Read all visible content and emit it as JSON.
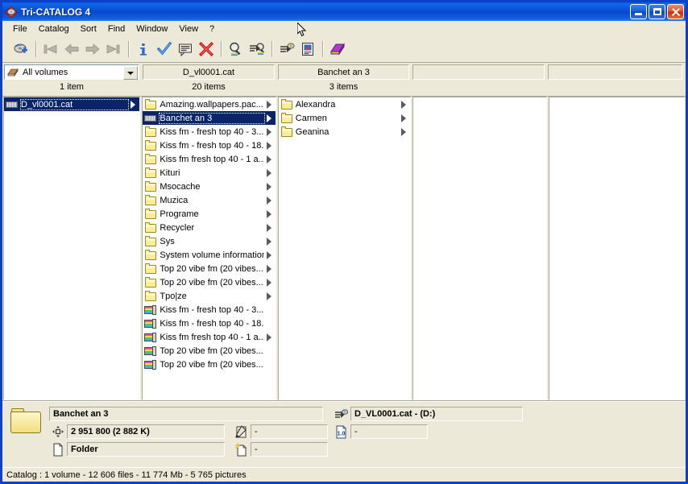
{
  "window": {
    "title": "Tri-CATALOG 4",
    "app_icon": "catalog-diamond-icon",
    "buttons": {
      "minimize": "Minimize",
      "maximize": "Maximize",
      "close": "Close"
    }
  },
  "menu": {
    "items": [
      {
        "label": "File",
        "name": "menu-file"
      },
      {
        "label": "Catalog",
        "name": "menu-catalog"
      },
      {
        "label": "Sort",
        "name": "menu-sort"
      },
      {
        "label": "Find",
        "name": "menu-find"
      },
      {
        "label": "Window",
        "name": "menu-window"
      },
      {
        "label": "View",
        "name": "menu-view"
      },
      {
        "label": "?",
        "name": "menu-help"
      }
    ]
  },
  "toolbar": {
    "buttons": [
      {
        "name": "add-catalog-icon",
        "glyph": "add-disk",
        "enabled": true
      },
      {
        "name": "first-record-icon",
        "glyph": "nav-first",
        "enabled": false
      },
      {
        "name": "previous-record-icon",
        "glyph": "nav-prev",
        "enabled": false
      },
      {
        "name": "next-record-icon",
        "glyph": "nav-next",
        "enabled": false
      },
      {
        "name": "last-record-icon",
        "glyph": "nav-last",
        "enabled": false
      },
      {
        "name": "info-icon",
        "glyph": "info",
        "enabled": true
      },
      {
        "name": "validate-icon",
        "glyph": "check",
        "enabled": true
      },
      {
        "name": "comment-icon",
        "glyph": "comment",
        "enabled": true
      },
      {
        "name": "delete-icon",
        "glyph": "delete-x",
        "enabled": true
      },
      {
        "name": "search-icon",
        "glyph": "magnifier",
        "enabled": true
      },
      {
        "name": "advanced-search-icon",
        "glyph": "magnifier-plus",
        "enabled": true
      },
      {
        "name": "disk-properties-icon",
        "glyph": "disk-props",
        "enabled": true
      },
      {
        "name": "thumbnail-icon",
        "glyph": "picture-doc",
        "enabled": true
      },
      {
        "name": "catalog-book-icon",
        "glyph": "book",
        "enabled": true
      }
    ]
  },
  "columns": [
    {
      "title": "All volumes",
      "count": "1 item",
      "type": "dropdown"
    },
    {
      "title": "D_vl0001.cat",
      "count": "20 items",
      "type": "label"
    },
    {
      "title": "Banchet an 3",
      "count": "3 items",
      "type": "label"
    },
    {
      "title": "",
      "count": "",
      "type": "label"
    },
    {
      "title": "",
      "count": "",
      "type": "label"
    }
  ],
  "panes": [
    {
      "name": "pane-volumes",
      "items": [
        {
          "label": "D_vl0001.cat",
          "icon": "cd-icon",
          "arrow": true,
          "selected": true
        }
      ]
    },
    {
      "name": "pane-folders",
      "items": [
        {
          "label": "Amazing.wallpapers.pac...",
          "icon": "folder-icon",
          "arrow": true,
          "selected": false
        },
        {
          "label": "Banchet an 3",
          "icon": "cd-icon",
          "arrow": true,
          "selected": true
        },
        {
          "label": "Kiss fm - fresh top 40  - 3...",
          "icon": "folder-icon",
          "arrow": true,
          "selected": false
        },
        {
          "label": "Kiss fm - fresh top 40 - 18...",
          "icon": "folder-icon",
          "arrow": true,
          "selected": false
        },
        {
          "label": "Kiss fm fresh top 40 - 1 a...",
          "icon": "folder-icon",
          "arrow": true,
          "selected": false
        },
        {
          "label": "Kituri",
          "icon": "folder-icon",
          "arrow": true,
          "selected": false
        },
        {
          "label": "Msocache",
          "icon": "folder-icon",
          "arrow": true,
          "selected": false
        },
        {
          "label": "Muzica",
          "icon": "folder-icon",
          "arrow": true,
          "selected": false
        },
        {
          "label": "Programe",
          "icon": "folder-icon",
          "arrow": true,
          "selected": false
        },
        {
          "label": "Recycler",
          "icon": "folder-icon",
          "arrow": true,
          "selected": false
        },
        {
          "label": "Sys",
          "icon": "folder-icon",
          "arrow": true,
          "selected": false
        },
        {
          "label": "System volume information",
          "icon": "folder-icon",
          "arrow": true,
          "selected": false
        },
        {
          "label": "Top 20 vibe fm (20 vibes...",
          "icon": "folder-icon",
          "arrow": true,
          "selected": false
        },
        {
          "label": "Top 20 vibe fm (20 vibes...",
          "icon": "folder-icon",
          "arrow": true,
          "selected": false
        },
        {
          "label": "Tpo|ze",
          "icon": "folder-icon",
          "arrow": true,
          "selected": false
        },
        {
          "label": "Kiss fm - fresh top 40  - 3...",
          "icon": "disk-icon",
          "arrow": false,
          "selected": false
        },
        {
          "label": "Kiss fm - fresh top 40 - 18...",
          "icon": "disk-icon",
          "arrow": false,
          "selected": false
        },
        {
          "label": "Kiss fm fresh top 40 - 1 a...",
          "icon": "disk-icon",
          "arrow": true,
          "selected": false
        },
        {
          "label": "Top 20 vibe fm (20 vibes...",
          "icon": "disk-icon",
          "arrow": false,
          "selected": false
        },
        {
          "label": "Top 20 vibe fm (20 vibes...",
          "icon": "disk-icon",
          "arrow": false,
          "selected": false
        }
      ]
    },
    {
      "name": "pane-subfolders",
      "items": [
        {
          "label": "Alexandra",
          "icon": "folder-icon",
          "arrow": true,
          "selected": false
        },
        {
          "label": "Carmen",
          "icon": "folder-icon",
          "arrow": true,
          "selected": false
        },
        {
          "label": "Geanina",
          "icon": "folder-icon",
          "arrow": true,
          "selected": false
        }
      ]
    },
    {
      "name": "pane-empty-1",
      "items": []
    },
    {
      "name": "pane-empty-2",
      "items": []
    }
  ],
  "detail": {
    "icon": "folder-large-icon",
    "name_value": "Banchet an 3",
    "size_icon": "size-arrows-icon",
    "size_value": "2 951 800 (2 882 K)",
    "type_icon": "document-icon",
    "type_value": "Folder",
    "comment_icon": "comment-edit-icon",
    "comment_value": "-",
    "created_icon": "new-document-icon",
    "created_value": "-",
    "volume_icon": "disk-props-icon",
    "volume_value": "D_VL0001.cat - (D:)",
    "version_icon": "version-icon",
    "version_value": "-"
  },
  "statusbar": {
    "text": "Catalog : 1 volume - 12 606 files - 11 774 Mb - 5 765 pictures"
  },
  "colors": {
    "titlebar_blue": "#0a51d8",
    "window_border": "#0a41c8",
    "face": "#ece9d8",
    "selection": "#0a246a",
    "folder_yellow": "#fbec9a"
  }
}
